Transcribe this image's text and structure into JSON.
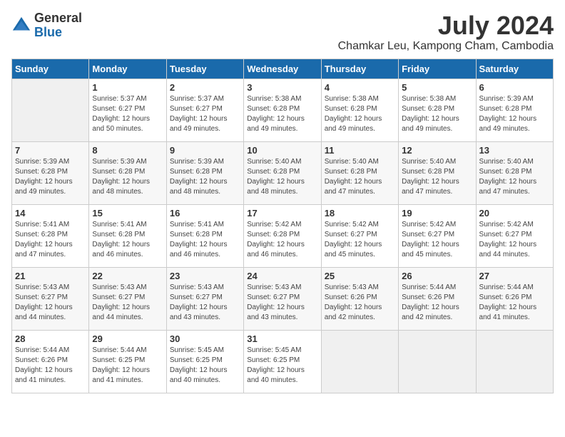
{
  "logo": {
    "general": "General",
    "blue": "Blue"
  },
  "title": {
    "month_year": "July 2024",
    "location": "Chamkar Leu, Kampong Cham, Cambodia"
  },
  "weekdays": [
    "Sunday",
    "Monday",
    "Tuesday",
    "Wednesday",
    "Thursday",
    "Friday",
    "Saturday"
  ],
  "weeks": [
    [
      {
        "day": "",
        "sunrise": "",
        "sunset": "",
        "daylight": "",
        "empty": true
      },
      {
        "day": "1",
        "sunrise": "Sunrise: 5:37 AM",
        "sunset": "Sunset: 6:27 PM",
        "daylight": "Daylight: 12 hours and 50 minutes."
      },
      {
        "day": "2",
        "sunrise": "Sunrise: 5:37 AM",
        "sunset": "Sunset: 6:27 PM",
        "daylight": "Daylight: 12 hours and 49 minutes."
      },
      {
        "day": "3",
        "sunrise": "Sunrise: 5:38 AM",
        "sunset": "Sunset: 6:28 PM",
        "daylight": "Daylight: 12 hours and 49 minutes."
      },
      {
        "day": "4",
        "sunrise": "Sunrise: 5:38 AM",
        "sunset": "Sunset: 6:28 PM",
        "daylight": "Daylight: 12 hours and 49 minutes."
      },
      {
        "day": "5",
        "sunrise": "Sunrise: 5:38 AM",
        "sunset": "Sunset: 6:28 PM",
        "daylight": "Daylight: 12 hours and 49 minutes."
      },
      {
        "day": "6",
        "sunrise": "Sunrise: 5:39 AM",
        "sunset": "Sunset: 6:28 PM",
        "daylight": "Daylight: 12 hours and 49 minutes."
      }
    ],
    [
      {
        "day": "7",
        "sunrise": "Sunrise: 5:39 AM",
        "sunset": "Sunset: 6:28 PM",
        "daylight": "Daylight: 12 hours and 49 minutes."
      },
      {
        "day": "8",
        "sunrise": "Sunrise: 5:39 AM",
        "sunset": "Sunset: 6:28 PM",
        "daylight": "Daylight: 12 hours and 48 minutes."
      },
      {
        "day": "9",
        "sunrise": "Sunrise: 5:39 AM",
        "sunset": "Sunset: 6:28 PM",
        "daylight": "Daylight: 12 hours and 48 minutes."
      },
      {
        "day": "10",
        "sunrise": "Sunrise: 5:40 AM",
        "sunset": "Sunset: 6:28 PM",
        "daylight": "Daylight: 12 hours and 48 minutes."
      },
      {
        "day": "11",
        "sunrise": "Sunrise: 5:40 AM",
        "sunset": "Sunset: 6:28 PM",
        "daylight": "Daylight: 12 hours and 47 minutes."
      },
      {
        "day": "12",
        "sunrise": "Sunrise: 5:40 AM",
        "sunset": "Sunset: 6:28 PM",
        "daylight": "Daylight: 12 hours and 47 minutes."
      },
      {
        "day": "13",
        "sunrise": "Sunrise: 5:40 AM",
        "sunset": "Sunset: 6:28 PM",
        "daylight": "Daylight: 12 hours and 47 minutes."
      }
    ],
    [
      {
        "day": "14",
        "sunrise": "Sunrise: 5:41 AM",
        "sunset": "Sunset: 6:28 PM",
        "daylight": "Daylight: 12 hours and 47 minutes."
      },
      {
        "day": "15",
        "sunrise": "Sunrise: 5:41 AM",
        "sunset": "Sunset: 6:28 PM",
        "daylight": "Daylight: 12 hours and 46 minutes."
      },
      {
        "day": "16",
        "sunrise": "Sunrise: 5:41 AM",
        "sunset": "Sunset: 6:28 PM",
        "daylight": "Daylight: 12 hours and 46 minutes."
      },
      {
        "day": "17",
        "sunrise": "Sunrise: 5:42 AM",
        "sunset": "Sunset: 6:28 PM",
        "daylight": "Daylight: 12 hours and 46 minutes."
      },
      {
        "day": "18",
        "sunrise": "Sunrise: 5:42 AM",
        "sunset": "Sunset: 6:27 PM",
        "daylight": "Daylight: 12 hours and 45 minutes."
      },
      {
        "day": "19",
        "sunrise": "Sunrise: 5:42 AM",
        "sunset": "Sunset: 6:27 PM",
        "daylight": "Daylight: 12 hours and 45 minutes."
      },
      {
        "day": "20",
        "sunrise": "Sunrise: 5:42 AM",
        "sunset": "Sunset: 6:27 PM",
        "daylight": "Daylight: 12 hours and 44 minutes."
      }
    ],
    [
      {
        "day": "21",
        "sunrise": "Sunrise: 5:43 AM",
        "sunset": "Sunset: 6:27 PM",
        "daylight": "Daylight: 12 hours and 44 minutes."
      },
      {
        "day": "22",
        "sunrise": "Sunrise: 5:43 AM",
        "sunset": "Sunset: 6:27 PM",
        "daylight": "Daylight: 12 hours and 44 minutes."
      },
      {
        "day": "23",
        "sunrise": "Sunrise: 5:43 AM",
        "sunset": "Sunset: 6:27 PM",
        "daylight": "Daylight: 12 hours and 43 minutes."
      },
      {
        "day": "24",
        "sunrise": "Sunrise: 5:43 AM",
        "sunset": "Sunset: 6:27 PM",
        "daylight": "Daylight: 12 hours and 43 minutes."
      },
      {
        "day": "25",
        "sunrise": "Sunrise: 5:43 AM",
        "sunset": "Sunset: 6:26 PM",
        "daylight": "Daylight: 12 hours and 42 minutes."
      },
      {
        "day": "26",
        "sunrise": "Sunrise: 5:44 AM",
        "sunset": "Sunset: 6:26 PM",
        "daylight": "Daylight: 12 hours and 42 minutes."
      },
      {
        "day": "27",
        "sunrise": "Sunrise: 5:44 AM",
        "sunset": "Sunset: 6:26 PM",
        "daylight": "Daylight: 12 hours and 41 minutes."
      }
    ],
    [
      {
        "day": "28",
        "sunrise": "Sunrise: 5:44 AM",
        "sunset": "Sunset: 6:26 PM",
        "daylight": "Daylight: 12 hours and 41 minutes."
      },
      {
        "day": "29",
        "sunrise": "Sunrise: 5:44 AM",
        "sunset": "Sunset: 6:25 PM",
        "daylight": "Daylight: 12 hours and 41 minutes."
      },
      {
        "day": "30",
        "sunrise": "Sunrise: 5:45 AM",
        "sunset": "Sunset: 6:25 PM",
        "daylight": "Daylight: 12 hours and 40 minutes."
      },
      {
        "day": "31",
        "sunrise": "Sunrise: 5:45 AM",
        "sunset": "Sunset: 6:25 PM",
        "daylight": "Daylight: 12 hours and 40 minutes."
      },
      {
        "day": "",
        "sunrise": "",
        "sunset": "",
        "daylight": "",
        "empty": true
      },
      {
        "day": "",
        "sunrise": "",
        "sunset": "",
        "daylight": "",
        "empty": true
      },
      {
        "day": "",
        "sunrise": "",
        "sunset": "",
        "daylight": "",
        "empty": true
      }
    ]
  ]
}
